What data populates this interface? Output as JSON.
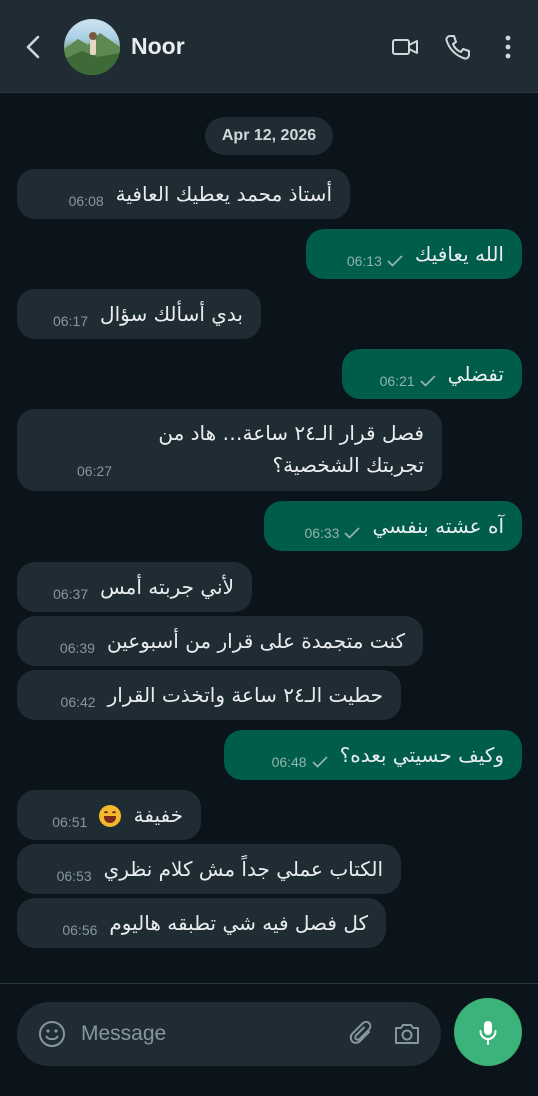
{
  "header": {
    "contact_name": "Noor",
    "icons": [
      "back-arrow-icon",
      "video-call-icon",
      "phone-icon",
      "more-vert-icon"
    ]
  },
  "chat": {
    "date": "Apr 12, 2026",
    "messages": [
      {
        "dir": "in",
        "text": "أستاذ محمد يعطيك العافية",
        "time": "06:08"
      },
      {
        "dir": "out",
        "text": "الله يعافيك",
        "time": "06:13"
      },
      {
        "dir": "in",
        "text": "بدي أسألك سؤال",
        "time": "06:17"
      },
      {
        "dir": "out",
        "text": "تفضلي",
        "time": "06:21"
      },
      {
        "dir": "in",
        "text": "فصل قرار الـ٢٤ ساعة… هاد من تجربتك الشخصية؟",
        "time": "06:27"
      },
      {
        "dir": "out",
        "text": "آه عشته بنفسي",
        "time": "06:33"
      },
      {
        "dir": "in",
        "text": "لأني جربته أمس",
        "time": "06:37"
      },
      {
        "dir": "in",
        "text": "كنت متجمدة على قرار من أسبوعين",
        "time": "06:39"
      },
      {
        "dir": "in",
        "text": "حطيت الـ٢٤ ساعة واتخذت القرار",
        "time": "06:42"
      },
      {
        "dir": "out",
        "text": "وكيف حسيتي بعده؟",
        "time": "06:48"
      },
      {
        "dir": "in",
        "text": "خفيفة",
        "emoji": "grinning-face-icon",
        "time": "06:51"
      },
      {
        "dir": "in",
        "text": "الكتاب عملي جداً مش كلام نظري",
        "time": "06:53"
      },
      {
        "dir": "in",
        "text": "كل فصل فيه شي تطبقه هاليوم",
        "time": "06:56"
      }
    ]
  },
  "composer": {
    "placeholder": "Message",
    "icons": [
      "emoji-icon",
      "attach-icon",
      "camera-icon",
      "mic-icon"
    ]
  },
  "colors": {
    "background": "#0b141a",
    "header": "#1f2c34",
    "incoming_bubble": "#202c33",
    "outgoing_bubble": "#005c4b",
    "mic_button": "#3cb37a"
  }
}
